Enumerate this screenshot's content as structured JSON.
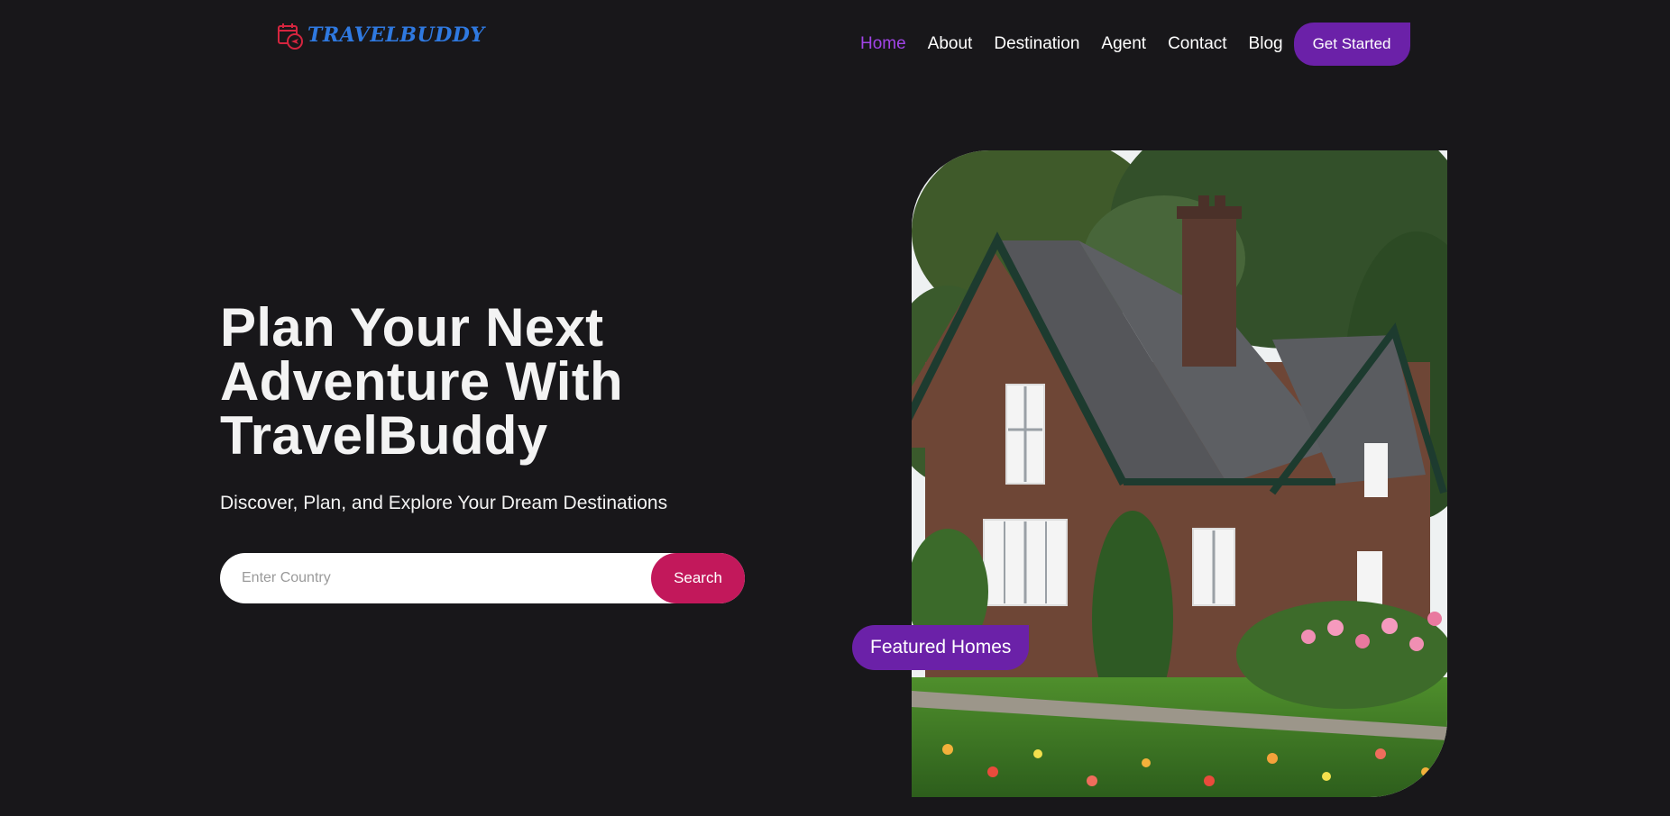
{
  "brand": {
    "name": "TRAVELBUDDY",
    "logo_icon": "calendar-plane-icon",
    "color": "#2f79e0",
    "icon_color": "#d5253f"
  },
  "nav": {
    "items": [
      {
        "label": "Home",
        "active": true
      },
      {
        "label": "About"
      },
      {
        "label": "Destination"
      },
      {
        "label": "Agent"
      },
      {
        "label": "Contact"
      },
      {
        "label": "Blog"
      }
    ],
    "cta_label": "Get Started"
  },
  "hero": {
    "title_lines": [
      "Plan Your Next",
      "Adventure With",
      "TravelBuddy"
    ],
    "subtitle": "Discover, Plan, and Explore Your Dream Destinations"
  },
  "search": {
    "placeholder": "Enter Country",
    "value": "",
    "button_label": "Search"
  },
  "featured": {
    "badge_label": "Featured Homes"
  },
  "colors": {
    "background": "#18171a",
    "accent_purple": "#6b21a8",
    "active_nav": "#a144e8",
    "search_button": "#c2185b"
  }
}
